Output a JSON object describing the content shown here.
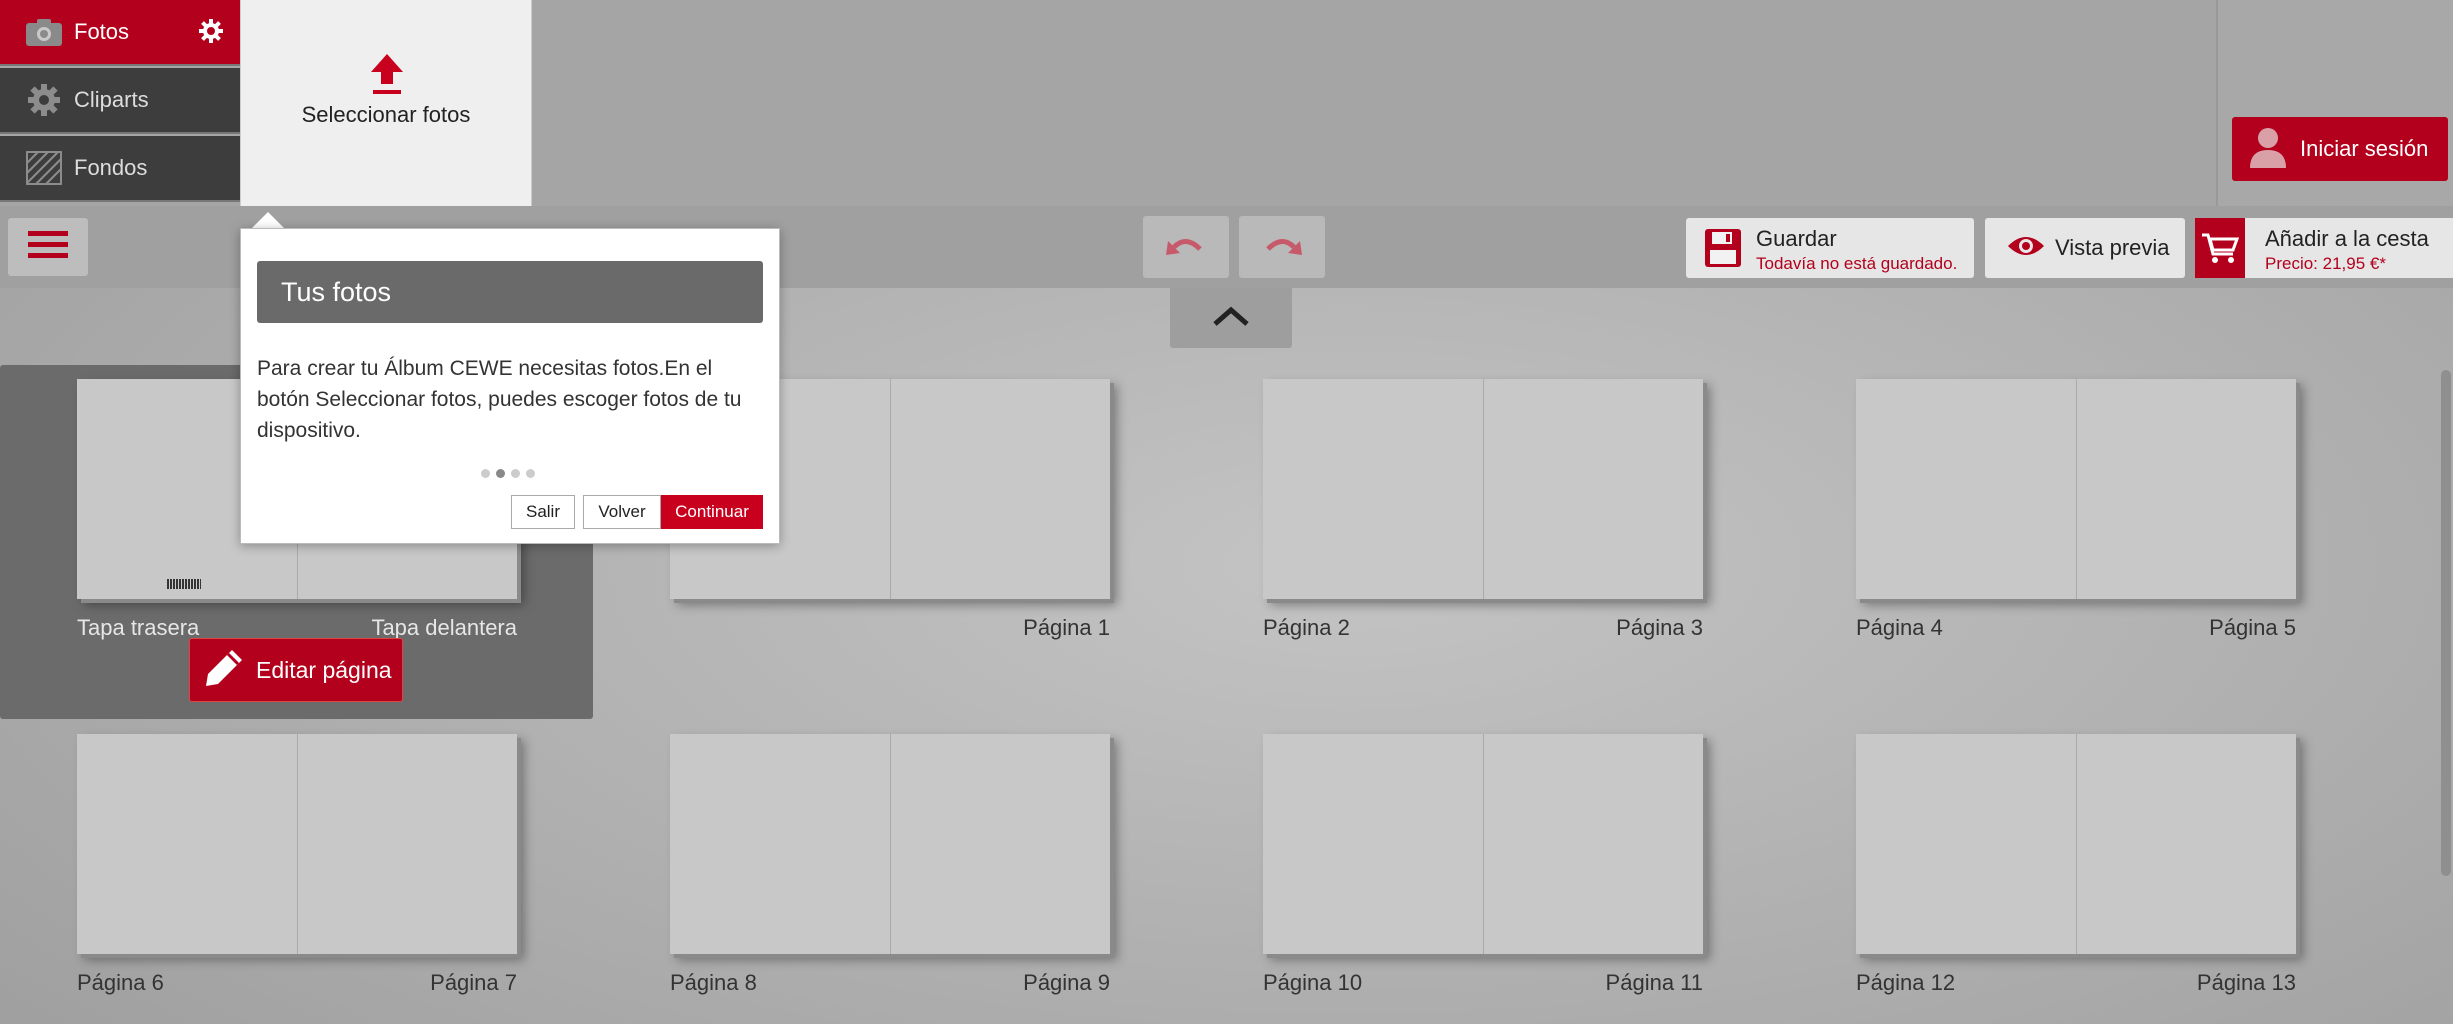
{
  "sidebar": {
    "tabs": [
      {
        "label": "Fotos",
        "icon": "camera-icon"
      },
      {
        "label": "Cliparts",
        "icon": "cog-icon"
      },
      {
        "label": "Fondos",
        "icon": "background-pattern-icon"
      }
    ]
  },
  "upload": {
    "label": "Seleccionar fotos",
    "icon": "upload-icon"
  },
  "toolbar": {
    "save_title": "Guardar",
    "save_status": "Todavía no está guardado.",
    "preview_label": "Vista previa",
    "cart_title": "Añadir a la cesta",
    "cart_price": "Precio: 21,95 €*",
    "login_label": "Iniciar sesión"
  },
  "pages": {
    "edit_label": "Editar página",
    "spreads": [
      {
        "left": "Tapa trasera",
        "right": "Tapa delantera"
      },
      {
        "left": "",
        "right": "Página 1"
      },
      {
        "left": "Página 2",
        "right": "Página 3"
      },
      {
        "left": "Página 4",
        "right": "Página 5"
      },
      {
        "left": "Página 6",
        "right": "Página 7"
      },
      {
        "left": "Página 8",
        "right": "Página 9"
      },
      {
        "left": "Página 10",
        "right": "Página 11"
      },
      {
        "left": "Página 12",
        "right": "Página 13"
      }
    ]
  },
  "tour": {
    "title": "Tus fotos",
    "body": "Para crear tu Álbum CEWE necesitas fotos.En el botón Seleccionar fotos, puedes escoger fotos de tu dispositivo.",
    "step_current": 2,
    "step_total": 4,
    "exit_label": "Salir",
    "back_label": "Volver",
    "continue_label": "Continuar"
  },
  "colors": {
    "brand": "#b3001c",
    "dark_panel": "#3d3d3d"
  }
}
